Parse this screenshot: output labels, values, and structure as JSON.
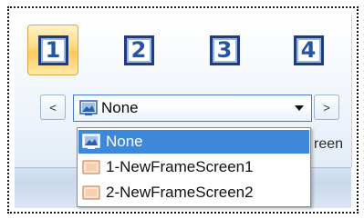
{
  "number_buttons": [
    {
      "label": "1",
      "active": true
    },
    {
      "label": "2",
      "active": false
    },
    {
      "label": "3",
      "active": false
    },
    {
      "label": "4",
      "active": false
    }
  ],
  "nav": {
    "prev_label": "<",
    "next_label": ">"
  },
  "combo": {
    "selected": "None"
  },
  "dropdown": {
    "items": [
      {
        "label": "None",
        "icon": "screen-none-icon",
        "selected": true
      },
      {
        "label": "1-NewFrameScreen1",
        "icon": "frame-screen-icon",
        "selected": false
      },
      {
        "label": "2-NewFrameScreen2",
        "icon": "frame-screen-icon",
        "selected": false
      }
    ]
  },
  "group_label_partial": "reen",
  "colors": {
    "highlight": "#3d88d8",
    "active_button": "#ffd980",
    "number_text": "#26569f"
  }
}
